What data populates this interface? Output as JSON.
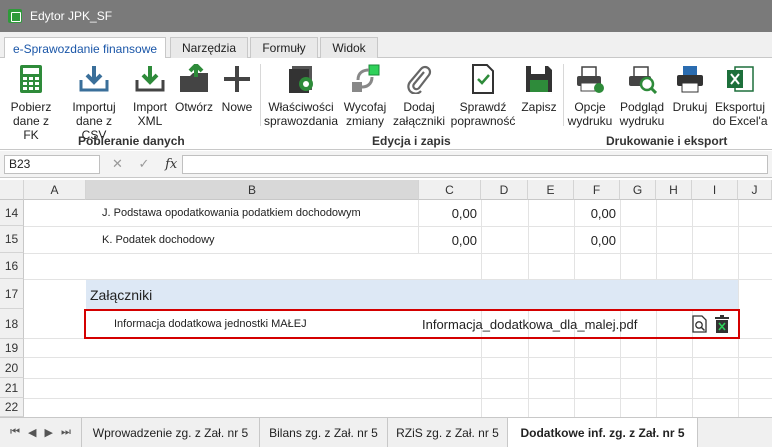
{
  "window": {
    "title": "Edytor JPK_SF"
  },
  "tabs": [
    {
      "label": "e-Sprawozdanie finansowe"
    },
    {
      "label": "Narzędzia"
    },
    {
      "label": "Formuły"
    },
    {
      "label": "Widok"
    }
  ],
  "ribbon": {
    "groups": {
      "data": "Pobieranie danych",
      "edit": "Edycja i zapis",
      "print": "Drukowanie i eksport"
    },
    "buttons": {
      "fetch_fk": "Pobierz\ndane z FK",
      "import_csv": "Importuj\ndane z CSV",
      "import_xml": "Import\nXML",
      "open": "Otwórz",
      "new": "Nowe",
      "properties": "Właściwości\nsprawozdania",
      "undo": "Wycofaj\nzmiany",
      "attach": "Dodaj\nzałączniki",
      "validate": "Sprawdź\npoprawność",
      "save": "Zapisz",
      "print_opts": "Opcje\nwydruku",
      "preview": "Podgląd\nwydruku",
      "print": "Drukuj",
      "export": "Eksportuj\ndo Excel'a"
    }
  },
  "formula_bar": {
    "cell_ref": "B23",
    "cancel": "✕",
    "confirm": "✓",
    "fx": "fx"
  },
  "columns": [
    "A",
    "B",
    "C",
    "D",
    "E",
    "F",
    "G",
    "H",
    "I",
    "J"
  ],
  "rows": {
    "r14": {
      "num": "14",
      "label": "J. Podstawa opodatkowania podatkiem dochodowym",
      "c": "0,00",
      "f": "0,00"
    },
    "r15": {
      "num": "15",
      "label": "K. Podatek dochodowy",
      "c": "0,00",
      "f": "0,00"
    },
    "r16": {
      "num": "16"
    },
    "r17": {
      "num": "17",
      "label": "Załączniki"
    },
    "r18": {
      "num": "18",
      "label": "Informacja dodatkowa jednostki MAŁEJ",
      "file": "Informacja_dodatkowa_dla_malej.pdf"
    },
    "r19": {
      "num": "19"
    },
    "r20": {
      "num": "20"
    },
    "r21": {
      "num": "21"
    },
    "r22": {
      "num": "22"
    }
  },
  "sheets": [
    {
      "label": "Wprowadzenie zg. z Zał. nr 5"
    },
    {
      "label": "Bilans zg. z Zał. nr 5"
    },
    {
      "label": "RZiS zg. z Zał. nr 5"
    },
    {
      "label": "Dodatkowe inf. zg. z Zał. nr 5"
    }
  ],
  "colors": {
    "accent": "#1a56a8",
    "highlight_border": "#d40000",
    "section_bg": "#dde8f5",
    "title_bg": "#7a7a7a"
  }
}
